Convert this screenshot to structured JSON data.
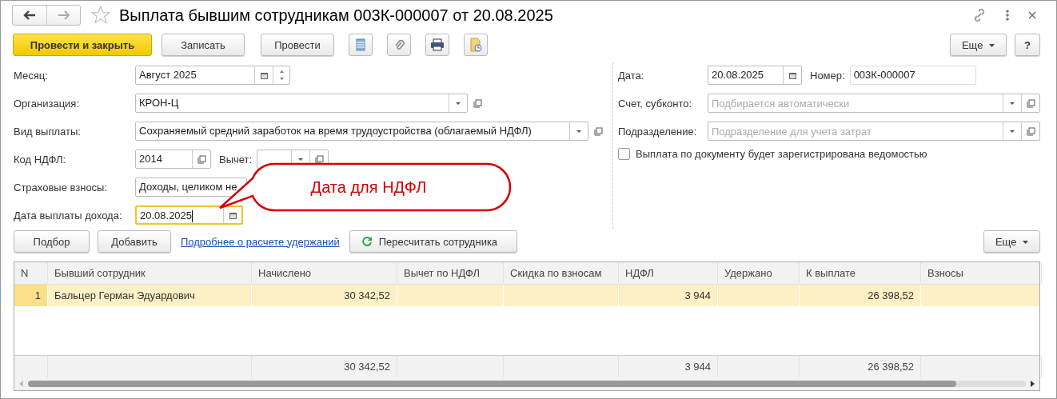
{
  "window": {
    "title": "Выплата бывшим сотрудникам 003К-000007 от 20.08.2025",
    "favorite": false
  },
  "toolbar": {
    "buttons": [
      {
        "label": "Провести и закрыть",
        "kind": "primary"
      },
      {
        "label": "Записать",
        "kind": "plain"
      },
      {
        "label": "Провести",
        "kind": "plain"
      }
    ],
    "more": "Еще",
    "help": "?"
  },
  "left": {
    "month": {
      "label": "Месяц:",
      "value": "Август 2025"
    },
    "organization": {
      "label": "Организация:",
      "value": "КРОН-Ц"
    },
    "payment_type": {
      "label": "Вид выплаты:",
      "value": "Сохраняемый средний заработок на время трудоустройства (облагаемый НДФЛ)"
    },
    "ndfl_code": {
      "label": "Код НДФЛ:",
      "value": "2014"
    },
    "deduction": {
      "label": "Вычет:"
    },
    "insurance": {
      "label": "Страховые взносы:",
      "value": "Доходы, целиком не"
    },
    "income_date": {
      "label": "Дата выплаты дохода:",
      "value": "20.08.2025",
      "focused": true
    }
  },
  "right": {
    "date": {
      "label": "Дата:",
      "value": "20.08.2025"
    },
    "number": {
      "label": "Номер:",
      "value": "003К-000007"
    },
    "account": {
      "label": "Счет, субконто:",
      "placeholder": "Подбирается автоматически"
    },
    "department": {
      "label": "Подразделение:",
      "placeholder": "Подразделение для учета затрат"
    },
    "checkbox": {
      "label": "Выплата по документу будет зарегистрирована ведомостью",
      "checked": false
    }
  },
  "callout": {
    "text": "Дата для НДФЛ"
  },
  "table_toolbar": {
    "buttons": [
      "Подбор",
      "Добавить"
    ],
    "link": "Подробнее о расчете удержаний",
    "recalc": "Пересчитать сотрудника",
    "more": "Еще"
  },
  "table": {
    "columns": [
      "N",
      "Бывший сотрудник",
      "Начислено",
      "Вычет по НДФЛ",
      "Скидка по взносам",
      "НДФЛ",
      "Удержано",
      "К выплате",
      "Взносы"
    ],
    "rows": [
      {
        "cells": [
          "1",
          "Бальцер Герман Эдуардович",
          "30 342,52",
          null,
          null,
          "3 944",
          null,
          "26 398,52",
          null
        ],
        "selected": true
      }
    ],
    "totals": {
      "accrued": "30 342,52",
      "ndfl": "3 944",
      "to_pay": "26 398,52"
    }
  }
}
